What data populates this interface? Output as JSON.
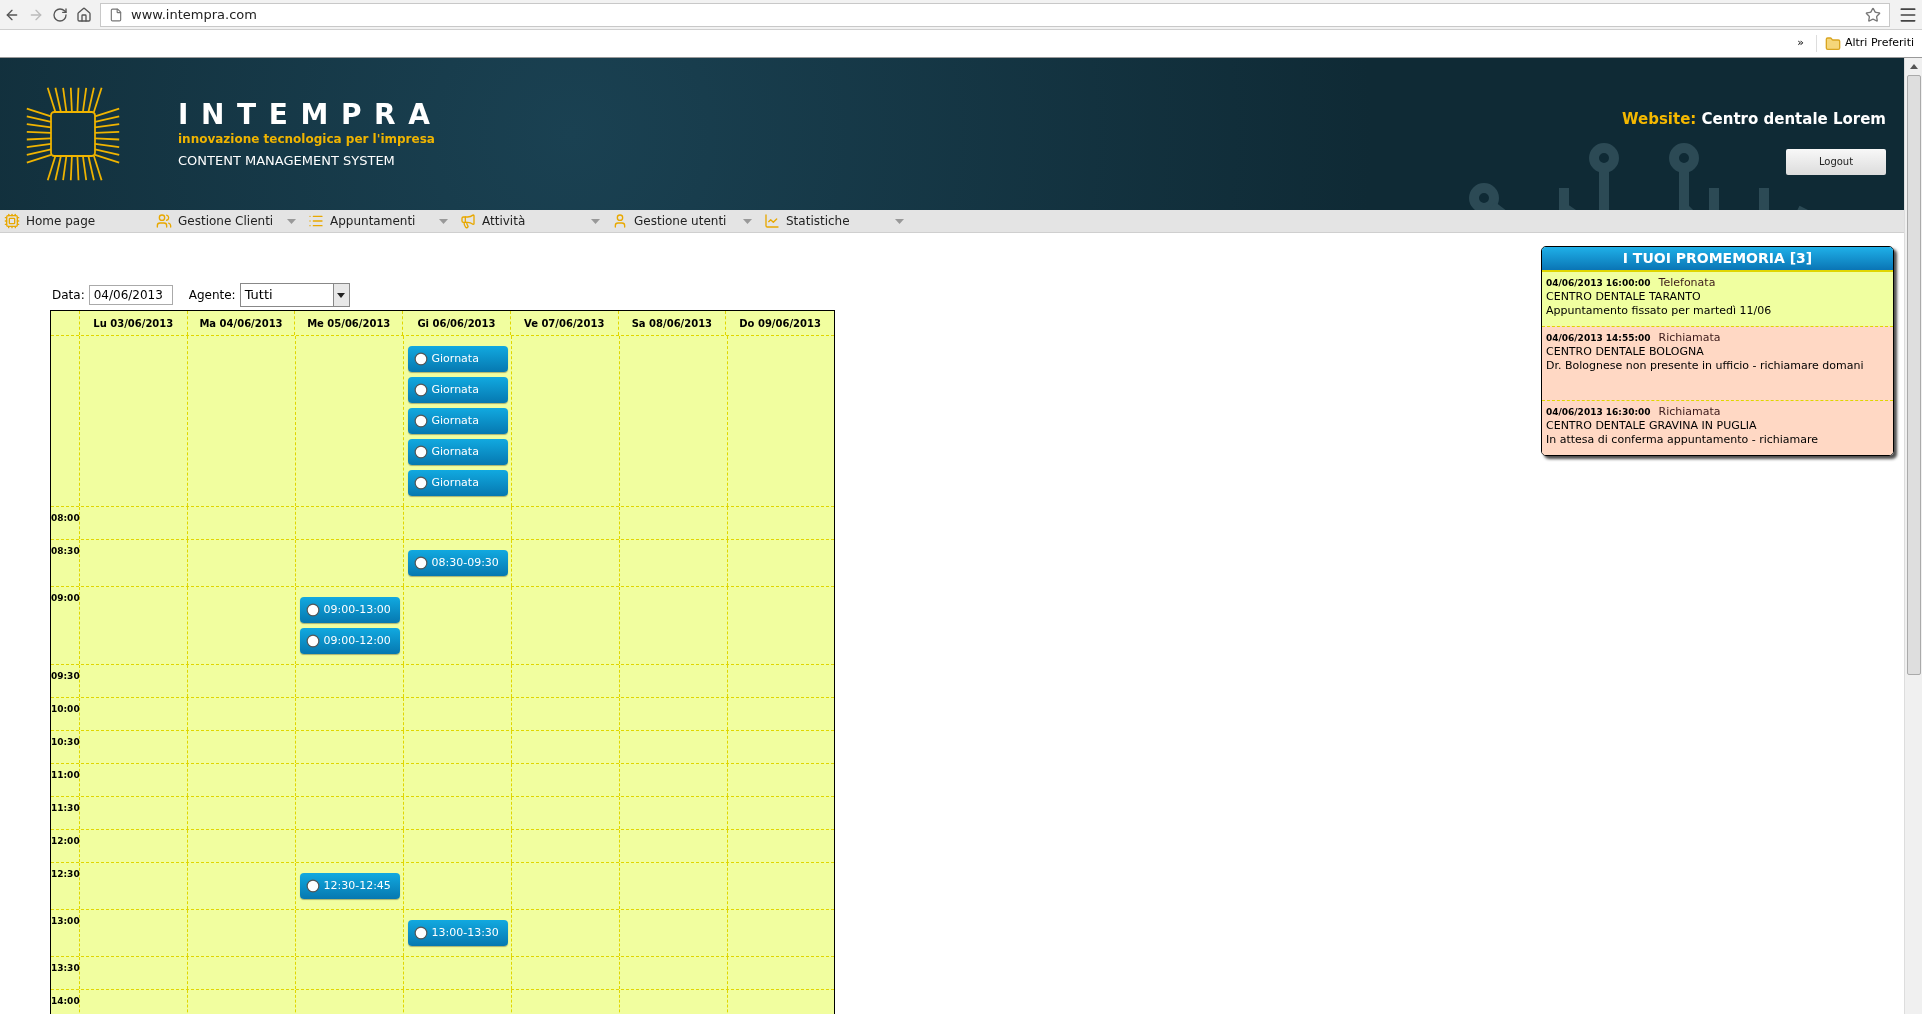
{
  "browser": {
    "url": "www.intempra.com",
    "bookmarks_overflow": "»",
    "bookmark_folder": "Altri Preferiti"
  },
  "header": {
    "brand": "INTEMPRA",
    "tagline": "innovazione tecnologica per l'impresa",
    "subtitle": "CONTENT MANAGEMENT SYSTEM",
    "website_label": "Website:",
    "website_name": "Centro dentale Lorem",
    "logout": "Logout"
  },
  "nav": [
    {
      "label": "Home page",
      "dropdown": false
    },
    {
      "label": "Gestione Clienti",
      "dropdown": true
    },
    {
      "label": "Appuntamenti",
      "dropdown": true
    },
    {
      "label": "Attività",
      "dropdown": true
    },
    {
      "label": "Gestione utenti",
      "dropdown": true
    },
    {
      "label": "Statistiche",
      "dropdown": true
    }
  ],
  "filters": {
    "date_label": "Data:",
    "date": "04/06/2013",
    "agent_label": "Agente:",
    "agent": "Tutti"
  },
  "calendar": {
    "days": [
      "Lu 03/06/2013",
      "Ma 04/06/2013",
      "Me 05/06/2013",
      "Gi 06/06/2013",
      "Ve 07/06/2013",
      "Sa 08/06/2013",
      "Do 09/06/2013"
    ],
    "rows": [
      {
        "cells": [
          {},
          {},
          {},
          {
            "events": [
              "Giornata",
              "Giornata",
              "Giornata",
              "Giornata",
              "Giornata"
            ]
          },
          {},
          {},
          {}
        ]
      },
      {
        "time": "08:00",
        "cells": [
          {},
          {},
          {},
          {},
          {},
          {},
          {}
        ]
      },
      {
        "time": "08:30",
        "cells": [
          {},
          {},
          {},
          {
            "events": [
              "08:30-09:30"
            ]
          },
          {},
          {},
          {}
        ]
      },
      {
        "time": "09:00",
        "cells": [
          {},
          {},
          {
            "events": [
              "09:00-13:00",
              "09:00-12:00"
            ]
          },
          {},
          {},
          {},
          {}
        ]
      },
      {
        "time": "09:30",
        "cells": [
          {},
          {},
          {},
          {},
          {},
          {},
          {}
        ]
      },
      {
        "time": "10:00",
        "cells": [
          {},
          {},
          {},
          {},
          {},
          {},
          {}
        ]
      },
      {
        "time": "10:30",
        "cells": [
          {},
          {},
          {},
          {},
          {},
          {},
          {}
        ]
      },
      {
        "time": "11:00",
        "cells": [
          {},
          {},
          {},
          {},
          {},
          {},
          {}
        ]
      },
      {
        "time": "11:30",
        "cells": [
          {},
          {},
          {},
          {},
          {},
          {},
          {}
        ]
      },
      {
        "time": "12:00",
        "cells": [
          {},
          {},
          {},
          {},
          {},
          {},
          {}
        ]
      },
      {
        "time": "12:30",
        "cells": [
          {},
          {},
          {
            "events": [
              "12:30-12:45"
            ]
          },
          {},
          {},
          {},
          {}
        ]
      },
      {
        "time": "13:00",
        "cells": [
          {},
          {},
          {},
          {
            "events": [
              "13:00-13:30"
            ]
          },
          {},
          {},
          {}
        ]
      },
      {
        "time": "13:30",
        "cells": [
          {},
          {},
          {},
          {},
          {},
          {},
          {}
        ]
      },
      {
        "time": "14:00",
        "cells": [
          {},
          {},
          {},
          {},
          {},
          {},
          {}
        ]
      }
    ]
  },
  "reminders": {
    "title": "I TUOI PROMEMORIA [3]",
    "items": [
      {
        "datetime": "04/06/2013 16:00:00",
        "type": "Telefonata",
        "client": "CENTRO DENTALE TARANTO",
        "note": "Appuntamento fissato per martedì 11/06",
        "color": "#f0ffa0"
      },
      {
        "datetime": "04/06/2013 14:55:00",
        "type": "Richiamata",
        "client": "CENTRO DENTALE BOLOGNA",
        "note": "Dr. Bolognese non presente in ufficio - richiamare domani",
        "color": "#ffd8c4"
      },
      {
        "datetime": "04/06/2013 16:30:00",
        "type": "Richiamata",
        "client": "CENTRO DENTALE GRAVINA IN PUGLIA",
        "note": "In attesa di conferma appuntamento - richiamare",
        "color": "#ffd8c4"
      }
    ]
  }
}
